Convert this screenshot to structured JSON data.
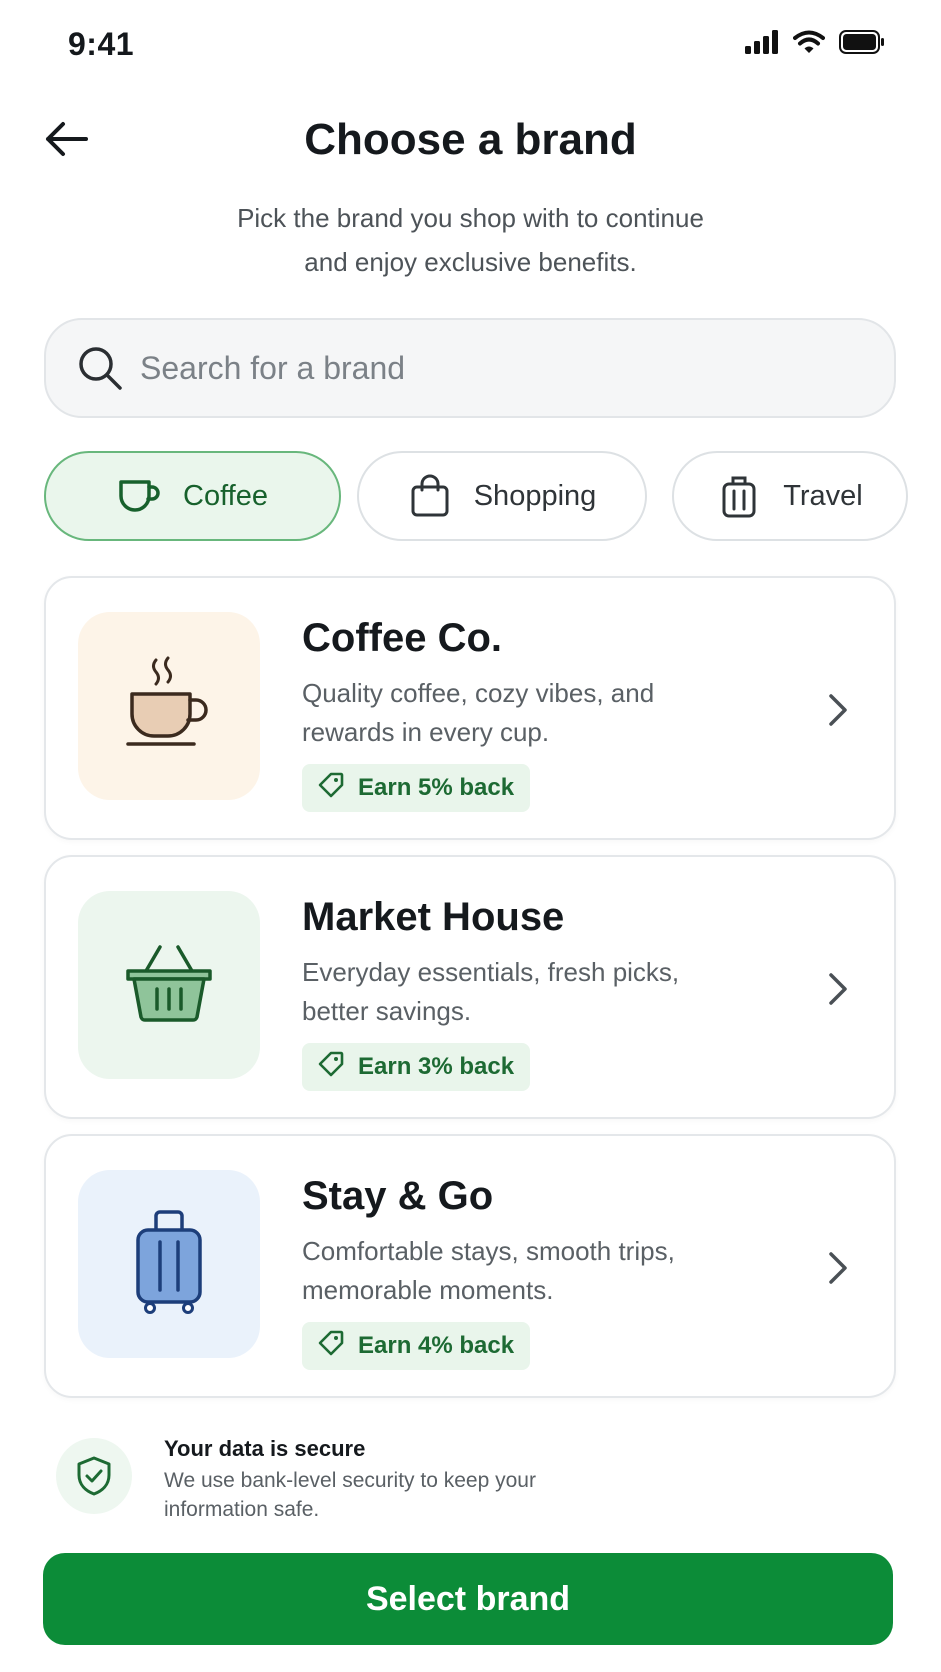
{
  "status_bar": {
    "time": "9:41"
  },
  "header": {
    "title": "Choose a brand"
  },
  "subtitle": {
    "line1": "Pick the brand you shop with to continue",
    "line2": "and enjoy exclusive benefits."
  },
  "search": {
    "placeholder": "Search for a brand",
    "value": ""
  },
  "categories": [
    {
      "label": "Coffee",
      "icon": "coffee-cup-icon",
      "active": true
    },
    {
      "label": "Shopping",
      "icon": "shopping-bag-icon",
      "active": false
    },
    {
      "label": "Travel",
      "icon": "luggage-icon",
      "active": false
    }
  ],
  "brands": [
    {
      "name": "Coffee Co.",
      "description": "Quality coffee, cozy vibes, and rewards in every cup.",
      "badge": "Earn 5% back",
      "icon": "steaming-coffee-cup-icon",
      "tile_color": "#fdf4e8"
    },
    {
      "name": "Market House",
      "description": "Everyday essentials, fresh picks, better savings.",
      "badge": "Earn 3% back",
      "icon": "shopping-basket-icon",
      "tile_color": "#ecf6ee"
    },
    {
      "name": "Stay & Go",
      "description": "Comfortable stays, smooth trips, memorable moments.",
      "badge": "Earn 4% back",
      "icon": "suitcase-icon",
      "tile_color": "#eaf2fb"
    }
  ],
  "security": {
    "title": "Your data is secure",
    "description": "We use bank-level security to keep your information safe."
  },
  "cta": {
    "label": "Select brand"
  },
  "colors": {
    "primary": "#0c8c38",
    "chip_active_bg": "#eaf6ec",
    "badge_bg": "#e9f5eb",
    "badge_text": "#1d6a33"
  }
}
